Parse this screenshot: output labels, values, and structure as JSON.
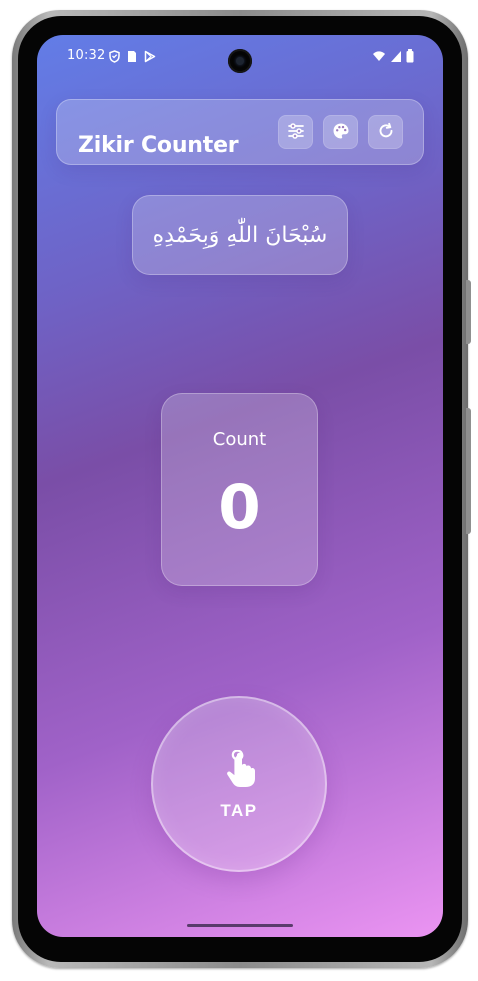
{
  "status_bar": {
    "time": "10:32",
    "left_icons": [
      "shield-icon",
      "sim-icon",
      "play-store-icon"
    ],
    "right_icons": [
      "wifi-icon",
      "signal-icon",
      "battery-icon"
    ]
  },
  "app": {
    "title": "Zikir Counter",
    "actions": [
      {
        "name": "settings-button",
        "icon": "sliders-icon"
      },
      {
        "name": "theme-button",
        "icon": "palette-icon"
      },
      {
        "name": "reset-button",
        "icon": "refresh-icon"
      }
    ]
  },
  "dhikr": {
    "text": "سُبْحَانَ اللّٰهِ وَبِحَمْدِهِ"
  },
  "counter": {
    "label": "Count",
    "value": 0
  },
  "tap": {
    "label": "TAP",
    "icon": "hand-tap-icon"
  },
  "colors": {
    "gradient_top": "#627de7",
    "gradient_middle": "#7a4ea7",
    "gradient_bottom": "#eb94f2",
    "text": "#ffffff"
  }
}
